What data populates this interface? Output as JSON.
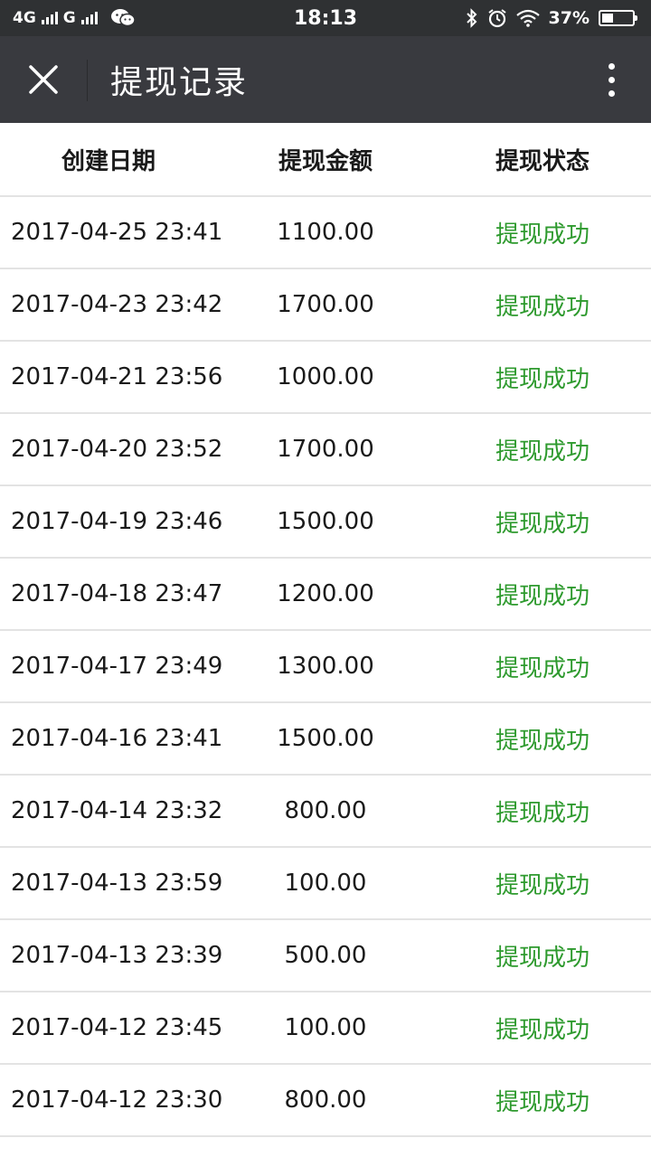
{
  "status_bar": {
    "network_1": "4G",
    "network_2": "G",
    "time": "18:13",
    "battery": "37%",
    "battery_level": 0.37
  },
  "nav": {
    "title": "提现记录"
  },
  "table": {
    "headers": {
      "date": "创建日期",
      "amount": "提现金额",
      "status": "提现状态"
    },
    "rows": [
      {
        "date": "2017-04-25 23:41",
        "amount": "1100.00",
        "status": "提现成功"
      },
      {
        "date": "2017-04-23 23:42",
        "amount": "1700.00",
        "status": "提现成功"
      },
      {
        "date": "2017-04-21 23:56",
        "amount": "1000.00",
        "status": "提现成功"
      },
      {
        "date": "2017-04-20 23:52",
        "amount": "1700.00",
        "status": "提现成功"
      },
      {
        "date": "2017-04-19 23:46",
        "amount": "1500.00",
        "status": "提现成功"
      },
      {
        "date": "2017-04-18 23:47",
        "amount": "1200.00",
        "status": "提现成功"
      },
      {
        "date": "2017-04-17 23:49",
        "amount": "1300.00",
        "status": "提现成功"
      },
      {
        "date": "2017-04-16 23:41",
        "amount": "1500.00",
        "status": "提现成功"
      },
      {
        "date": "2017-04-14 23:32",
        "amount": "800.00",
        "status": "提现成功"
      },
      {
        "date": "2017-04-13 23:59",
        "amount": "100.00",
        "status": "提现成功"
      },
      {
        "date": "2017-04-13 23:39",
        "amount": "500.00",
        "status": "提现成功"
      },
      {
        "date": "2017-04-12 23:45",
        "amount": "100.00",
        "status": "提现成功"
      },
      {
        "date": "2017-04-12 23:30",
        "amount": "800.00",
        "status": "提现成功"
      }
    ]
  },
  "colors": {
    "status_bar_bg": "#2f3133",
    "nav_bg": "#393a3f",
    "success_green": "#2e9a2e",
    "divider": "#e3e3e3"
  },
  "icons": {
    "close": "close-icon",
    "more": "more-vertical-icon",
    "bluetooth": "bluetooth-icon",
    "alarm": "alarm-icon",
    "wifi": "wifi-icon",
    "wechat": "wechat-icon"
  }
}
